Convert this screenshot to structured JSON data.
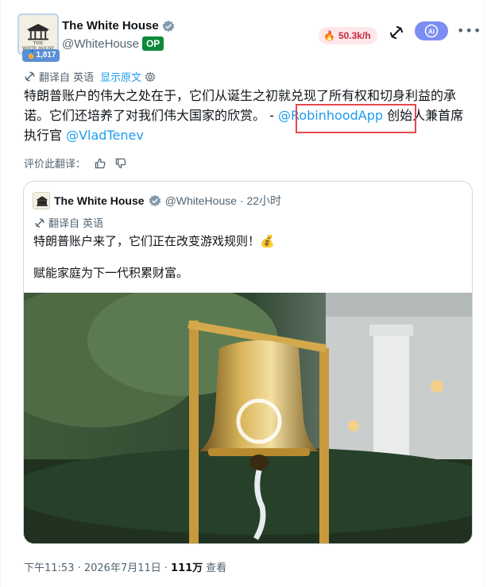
{
  "tweet": {
    "author_name": "The White House",
    "handle": "@WhiteHouse",
    "op_badge": "OP",
    "avatar_badge": "1,817",
    "rate_label": "50.3k/h",
    "ai_label": "AI",
    "translate_label": "翻译自 英语",
    "show_original": "显示原文",
    "text_part1": "特朗普账户的伟大之处在于，它们从诞生之初就兑现了所有权和切身利益的承诺。它们还培养了对我们伟大国家的欣赏。 - ",
    "mention1": "@RobinhoodApp",
    "text_part2": " 创始人兼首席执行官 ",
    "mention2": "@VladTenev",
    "rate_this": "评价此翻译：",
    "timestamp": "下午11:53 · 2026年7月11日 ·",
    "views_count": "111万",
    "views_label": "查看"
  },
  "quote": {
    "author_name": "The White House",
    "handle": "@WhiteHouse · 22小时",
    "translate_label": "翻译自 英语",
    "line1": "特朗普账户来了，它们正在改变游戏规则！💰",
    "line2": "赋能家庭为下一代积累财富。"
  },
  "colors": {
    "accent": "#1d9bf0",
    "op_badge": "#0e8a3a",
    "highlight": "#e5484d"
  }
}
